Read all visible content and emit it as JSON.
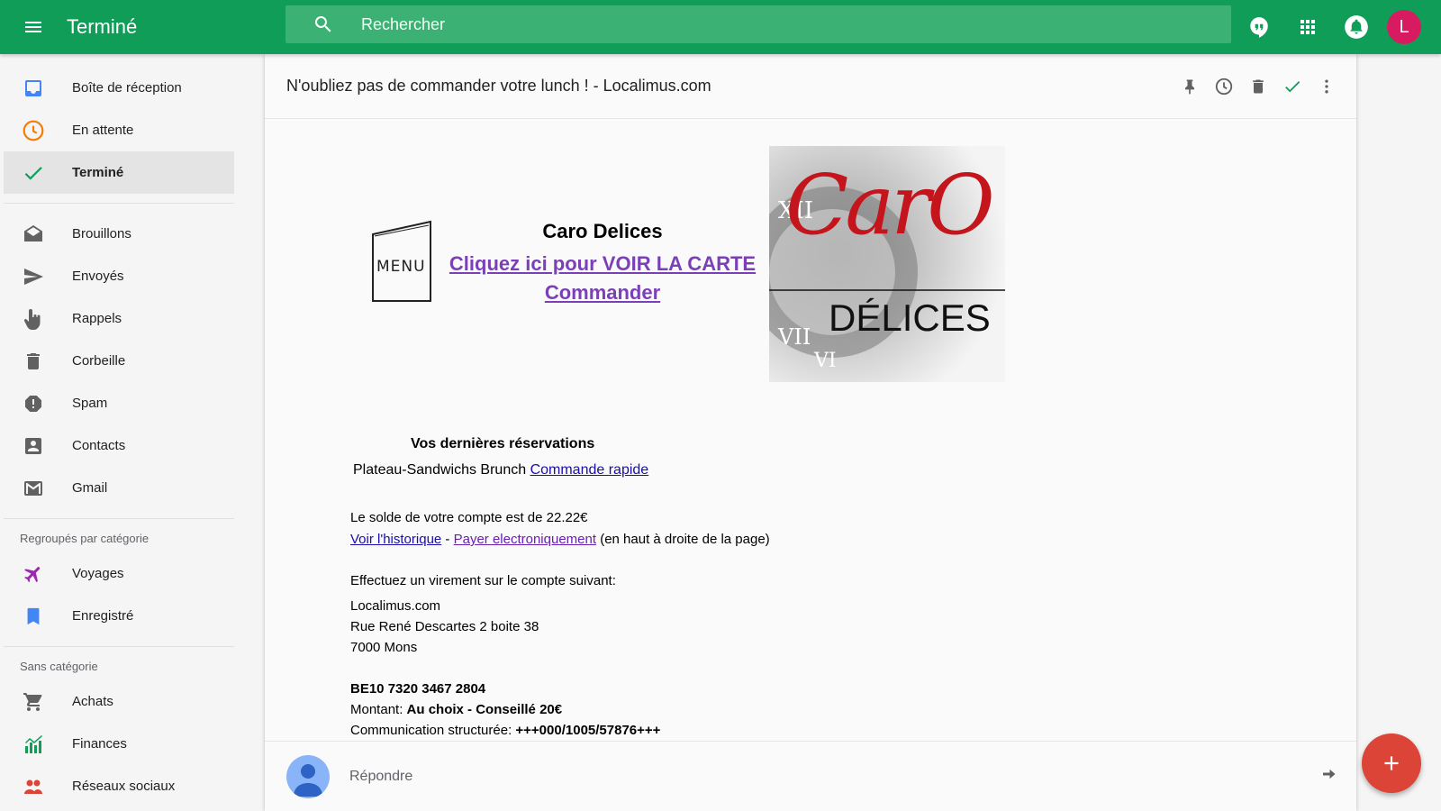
{
  "app": {
    "title": "Terminé"
  },
  "search": {
    "placeholder": "Rechercher"
  },
  "account": {
    "initial": "L"
  },
  "sidebar": {
    "items_top": [
      {
        "label": "Boîte de réception",
        "icon": "inbox-icon",
        "color": "#4285f4"
      },
      {
        "label": "En attente",
        "icon": "clock-icon",
        "color": "#f57c00"
      },
      {
        "label": "Terminé",
        "icon": "check-icon",
        "color": "#0f9d58",
        "active": true
      }
    ],
    "items_mid": [
      {
        "label": "Brouillons",
        "icon": "drafts-icon"
      },
      {
        "label": "Envoyés",
        "icon": "send-icon"
      },
      {
        "label": "Rappels",
        "icon": "reminder-hand-icon"
      },
      {
        "label": "Corbeille",
        "icon": "trash-icon"
      },
      {
        "label": "Spam",
        "icon": "spam-icon"
      },
      {
        "label": "Contacts",
        "icon": "contacts-icon"
      },
      {
        "label": "Gmail",
        "icon": "gmail-icon"
      }
    ],
    "section_grouped": "Regroupés par catégorie",
    "items_grouped": [
      {
        "label": "Voyages",
        "icon": "plane-icon",
        "color": "#9c27b0"
      },
      {
        "label": "Enregistré",
        "icon": "bookmark-icon",
        "color": "#4285f4"
      }
    ],
    "section_uncat": "Sans catégorie",
    "items_uncat": [
      {
        "label": "Achats",
        "icon": "cart-icon",
        "color": "#616161"
      },
      {
        "label": "Finances",
        "icon": "finance-chart-icon",
        "color": "#0f9d58"
      },
      {
        "label": "Réseaux sociaux",
        "icon": "social-icon",
        "color": "#db4437"
      }
    ]
  },
  "email": {
    "subject": "N'oubliez pas de commander votre lunch ! - Localimus.com",
    "menu_card_text": "MENU",
    "restaurant": "Caro Delices",
    "link_carte": "Cliquez ici pour VOIR LA CARTE",
    "link_commander": "Commander",
    "logo_script": "CarO",
    "logo_word": "DÉLICES",
    "res_title": "Vos dernières réservations",
    "res_item": "Plateau-Sandwichs Brunch",
    "res_link": "Commande rapide",
    "balance": "Le solde de votre compte est de 22.22€",
    "link_history": "Voir l'historique",
    "sep": " - ",
    "link_pay": "Payer electroniquement",
    "pay_note": " (en haut à droite de la page)",
    "transfer_intro": "Effectuez un virement sur le compte suivant:",
    "company": "Localimus.com",
    "street": "Rue René Descartes 2 boite 38",
    "city": "7000 Mons",
    "iban": "BE10 7320 3467 2804",
    "amount_label": "Montant: ",
    "amount_value": "Au choix - Conseillé 20€",
    "comm_label": "Communication structurée: ",
    "comm_value": "+++000/1005/57876+++"
  },
  "reply": {
    "label": "Répondre"
  },
  "colors": {
    "topbar": "#0f9d58",
    "fab": "#db4437",
    "avatar": "#d81b60"
  }
}
